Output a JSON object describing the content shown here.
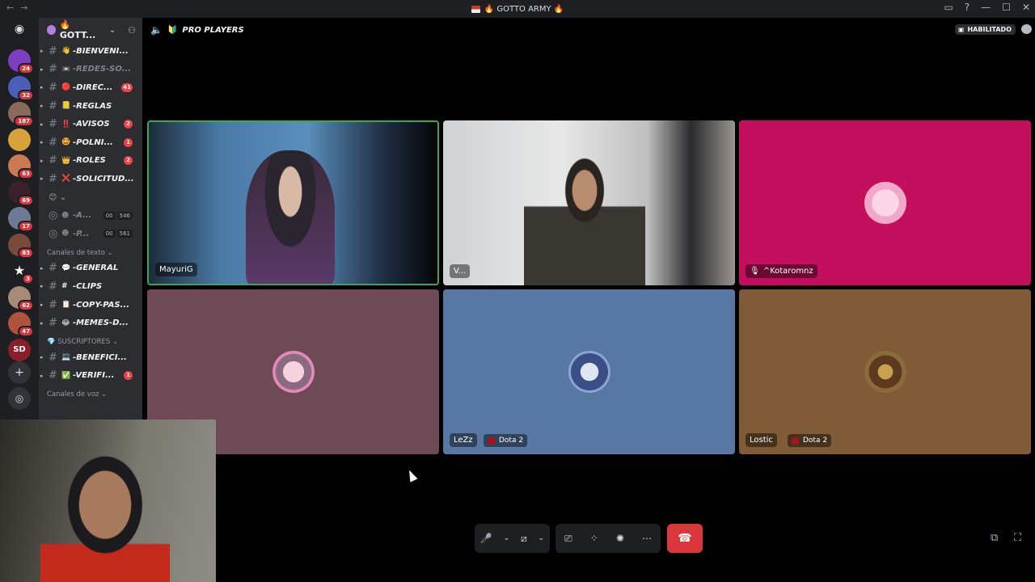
{
  "titlebar": {
    "back": "←",
    "forward": "→",
    "title": "🔥 GOTTO ARMY 🔥"
  },
  "servers": [
    {
      "badge": "24",
      "color": "#7b3fbf"
    },
    {
      "badge": "32",
      "color": "#4a5fb8"
    },
    {
      "badge": "187",
      "color": "#8a6a5c"
    },
    {
      "badge": "",
      "color": "#d6a23a"
    },
    {
      "badge": "63",
      "color": "#c97a52"
    },
    {
      "badge": "69",
      "color": "#3a2328"
    },
    {
      "badge": "17",
      "color": "#6c7a93"
    },
    {
      "badge": "83",
      "color": "#7a4a3a"
    },
    {
      "badge": "3",
      "color": "#1e1f22"
    },
    {
      "badge": "62",
      "color": "#a88876"
    },
    {
      "badge": "47",
      "color": "#b0533c"
    },
    {
      "badge": "",
      "color": "#8c1e2a"
    }
  ],
  "server_labels": {
    "sd": "SD"
  },
  "guild": {
    "name": "🔥 GOTT..."
  },
  "channels": [
    {
      "emoji": "👋",
      "name": "-BIENVENI...",
      "count": "",
      "muted": false
    },
    {
      "emoji": "📼",
      "name": "-REDES-SO...",
      "count": "",
      "muted": true
    },
    {
      "emoji": "🔴",
      "name": "-DIREC...",
      "count": "41",
      "muted": false
    },
    {
      "emoji": "📒",
      "name": "-REGLAS",
      "count": "",
      "muted": false
    },
    {
      "emoji": "‼️",
      "name": "-AVISOS",
      "count": "2",
      "muted": false
    },
    {
      "emoji": "🤩",
      "name": "-POLNI...",
      "count": "1",
      "muted": false
    },
    {
      "emoji": "👑",
      "name": "-ROLES",
      "count": "2",
      "muted": false
    },
    {
      "emoji": "❌",
      "name": "-SOLICITUD...",
      "count": "",
      "muted": false
    }
  ],
  "emoji_row": "😊 ⌄",
  "voice_stats": [
    {
      "name": "-A...",
      "a": "00",
      "b": "546"
    },
    {
      "name": "-P...",
      "a": "00",
      "b": "561"
    }
  ],
  "cat_text": "Canales de texto ⌄",
  "text_channels": [
    {
      "emoji": "💬",
      "name": "-GENERAL",
      "count": ""
    },
    {
      "emoji": "#",
      "name": "-CLIPS",
      "count": ""
    },
    {
      "emoji": "📋",
      "name": "-COPY-PAS...",
      "count": ""
    },
    {
      "emoji": "😂",
      "name": "-MEMES-D...",
      "count": ""
    }
  ],
  "cat_subs": "💎 SUSCRIPTORES ⌄",
  "sub_channels": [
    {
      "emoji": "💻",
      "name": "-BENEFICI...",
      "count": ""
    },
    {
      "emoji": "✅",
      "name": "-VERIFI...",
      "count": "1"
    }
  ],
  "cat_voice": "Canales de voz ⌄",
  "call": {
    "channel": "PRO PLAYERS",
    "status": "HABILITADO"
  },
  "tiles": [
    {
      "name": "MayuriG",
      "game": ""
    },
    {
      "name": "V...",
      "game": ""
    },
    {
      "name": "^Kotaromnz",
      "game": ""
    },
    {
      "name": "",
      "game": ""
    },
    {
      "name": "LeZz",
      "game": "Dota 2"
    },
    {
      "name": "Lostic",
      "game": "Dota 2"
    }
  ],
  "colors": {
    "speaking": "#3ba55c",
    "hangup": "#da373c",
    "tile3": "#c30f5e",
    "tile4": "#6e4a57",
    "tile5": "#5878a3",
    "tile6": "#7f5b37"
  }
}
